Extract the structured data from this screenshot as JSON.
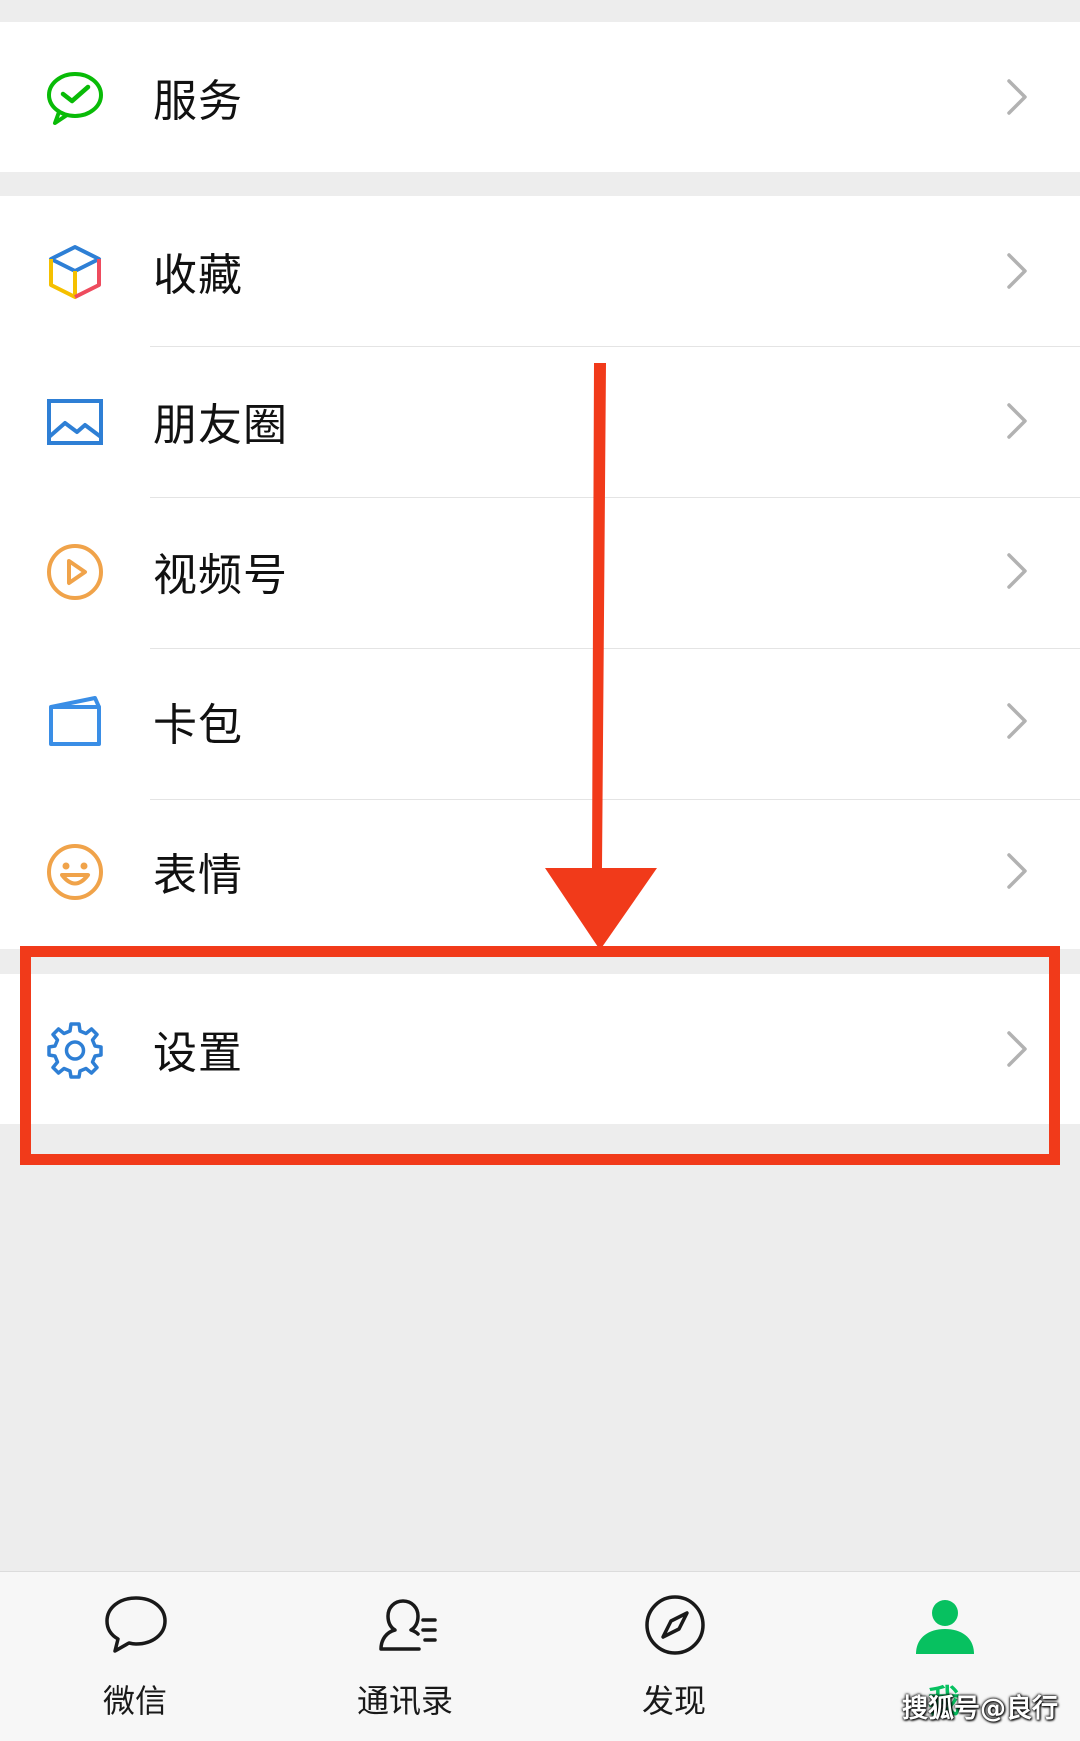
{
  "menu": {
    "services": {
      "label": "服务",
      "icon": "wechat-pay-icon",
      "color": "#09bb07"
    },
    "items": [
      {
        "label": "收藏",
        "icon": "favorites-cube-icon"
      },
      {
        "label": "朋友圈",
        "icon": "moments-picture-icon",
        "color": "#2e7fd5"
      },
      {
        "label": "视频号",
        "icon": "channels-play-icon",
        "color": "#f0a34a"
      },
      {
        "label": "卡包",
        "icon": "card-wallet-icon",
        "color": "#3a8ee6"
      },
      {
        "label": "表情",
        "icon": "sticker-smiley-icon",
        "color": "#f0a34a"
      }
    ],
    "settings": {
      "label": "设置",
      "icon": "gear-icon",
      "color": "#2e7fd5"
    }
  },
  "tabbar": {
    "tabs": [
      {
        "label": "微信",
        "icon": "chat-bubble-icon"
      },
      {
        "label": "通讯录",
        "icon": "contacts-icon"
      },
      {
        "label": "发现",
        "icon": "compass-icon"
      },
      {
        "label": "我",
        "icon": "person-icon",
        "active": true
      }
    ],
    "active_color": "#07c160"
  },
  "annotation": {
    "color": "#f13a1a"
  },
  "watermark": "搜狐号@良行"
}
